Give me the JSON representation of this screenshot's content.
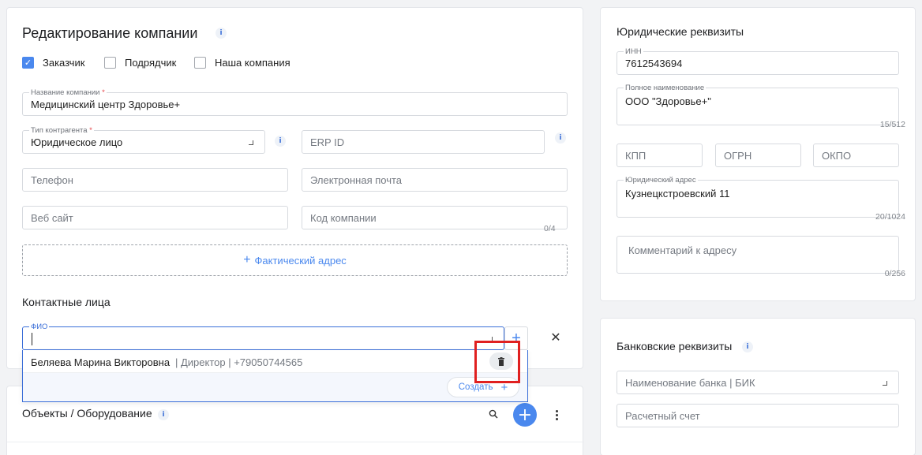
{
  "edit_company": {
    "title": "Редактирование компании",
    "roles": [
      {
        "label": "Заказчик",
        "checked": true
      },
      {
        "label": "Подрядчик",
        "checked": false
      },
      {
        "label": "Наша компания",
        "checked": false
      }
    ],
    "company_name": {
      "label": "Название компании",
      "required_mark": "*",
      "value": "Медицинский центр Здоровье+"
    },
    "counterparty_type": {
      "label": "Тип контрагента",
      "required_mark": "*",
      "value": "Юридическое лицо"
    },
    "erp_id": {
      "placeholder": "ERP ID"
    },
    "phone": {
      "placeholder": "Телефон"
    },
    "email": {
      "placeholder": "Электронная почта"
    },
    "website": {
      "placeholder": "Веб сайт"
    },
    "company_code": {
      "placeholder": "Код компании",
      "counter": "0/4"
    },
    "actual_address_button": "Фактический адрес",
    "contacts": {
      "title": "Контактные лица",
      "fio_label": "ФИО",
      "fio_value": "",
      "suggestions": [
        {
          "name": "Беляева Марина Викторовна",
          "meta": "| Директор | +79050744565"
        }
      ],
      "create_label": "Создать"
    }
  },
  "objects": {
    "title": "Объекты / Оборудование"
  },
  "legal": {
    "title": "Юридические реквизиты",
    "inn": {
      "label": "ИНН",
      "value": "7612543694"
    },
    "full_name": {
      "label": "Полное наименование",
      "value": "ООО \"Здоровье+\"",
      "counter": "15/512"
    },
    "kpp": {
      "placeholder": "КПП"
    },
    "ogrn": {
      "placeholder": "ОГРН"
    },
    "okpo": {
      "placeholder": "ОКПО"
    },
    "legal_address": {
      "label": "Юридический адрес",
      "value": "Кузнецкстроевский 11",
      "counter": "20/1024"
    },
    "address_comment": {
      "placeholder": "Комментарий к адресу",
      "counter": "0/256"
    }
  },
  "bank": {
    "title": "Банковские реквизиты",
    "bank_name": {
      "placeholder": "Наименование банка | БИК"
    },
    "account": {
      "placeholder": "Расчетный счет"
    }
  },
  "colors": {
    "accent": "#4a88ee",
    "highlight": "#e02020"
  }
}
